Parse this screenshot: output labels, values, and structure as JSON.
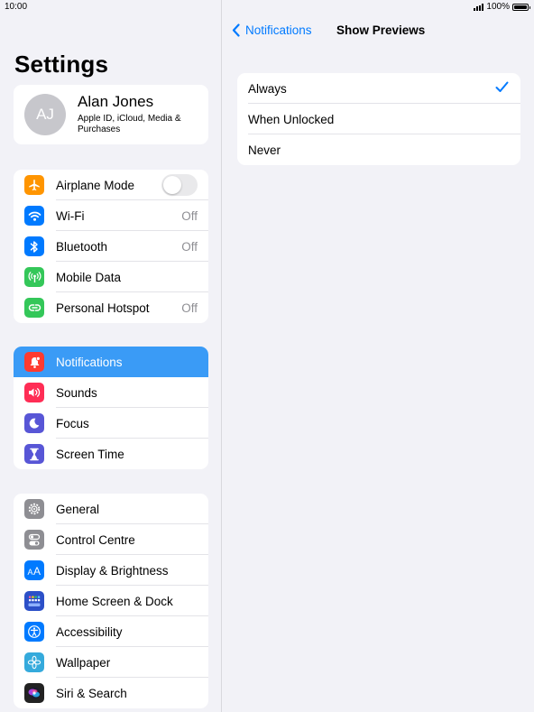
{
  "status": {
    "time": "10:00",
    "battery": "100%",
    "battery_level": 1.0
  },
  "sidebar": {
    "title": "Settings",
    "profile": {
      "initials": "AJ",
      "name": "Alan Jones",
      "subtitle": "Apple ID, iCloud, Media & Purchases"
    },
    "group1": [
      {
        "label": "Airplane Mode",
        "icon": "airplane-icon",
        "color": "#ff9500",
        "toggle": false
      },
      {
        "label": "Wi-Fi",
        "icon": "wifi-icon",
        "color": "#007aff",
        "value": "Off"
      },
      {
        "label": "Bluetooth",
        "icon": "bluetooth-icon",
        "color": "#007aff",
        "value": "Off"
      },
      {
        "label": "Mobile Data",
        "icon": "antenna-icon",
        "color": "#34c759"
      },
      {
        "label": "Personal Hotspot",
        "icon": "hotspot-icon",
        "color": "#34c759",
        "value": "Off"
      }
    ],
    "group2": [
      {
        "label": "Notifications",
        "icon": "notification-bell-icon",
        "color": "#ff3b30",
        "selected": true
      },
      {
        "label": "Sounds",
        "icon": "speaker-icon",
        "color": "#ff2d55"
      },
      {
        "label": "Focus",
        "icon": "moon-icon",
        "color": "#5856d6"
      },
      {
        "label": "Screen Time",
        "icon": "hourglass-icon",
        "color": "#5856d6"
      }
    ],
    "group3": [
      {
        "label": "General",
        "icon": "gear-icon",
        "color": "#8e8e93"
      },
      {
        "label": "Control Centre",
        "icon": "switches-icon",
        "color": "#8e8e93"
      },
      {
        "label": "Display & Brightness",
        "icon": "text-size-icon",
        "color": "#007aff"
      },
      {
        "label": "Home Screen & Dock",
        "icon": "app-grid-icon",
        "color": "#2c50c8"
      },
      {
        "label": "Accessibility",
        "icon": "accessibility-icon",
        "color": "#007aff"
      },
      {
        "label": "Wallpaper",
        "icon": "flower-icon",
        "color": "#35aadc"
      },
      {
        "label": "Siri & Search",
        "icon": "siri-icon",
        "color": "#222222"
      }
    ]
  },
  "detail": {
    "back_label": "Notifications",
    "title": "Show Previews",
    "options": [
      {
        "label": "Always",
        "checked": true
      },
      {
        "label": "When Unlocked",
        "checked": false
      },
      {
        "label": "Never",
        "checked": false
      }
    ],
    "accent": "#007aff"
  }
}
